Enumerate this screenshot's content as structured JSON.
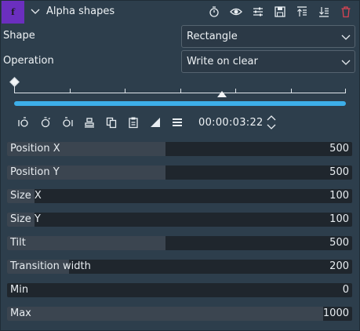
{
  "effect": {
    "badge": "f",
    "title": "Alpha shapes"
  },
  "fields": {
    "shape_label": "Shape",
    "shape_value": "Rectangle",
    "operation_label": "Operation",
    "operation_value": "Write on clear"
  },
  "timeline": {
    "timecode": "00:00:03:22"
  },
  "params": [
    {
      "name": "Position X",
      "value": "500",
      "fraction": 0.46
    },
    {
      "name": "Position Y",
      "value": "500",
      "fraction": 0.46
    },
    {
      "name": "Size X",
      "value": "100",
      "fraction": 0.08
    },
    {
      "name": "Size Y",
      "value": "100",
      "fraction": 0.08
    },
    {
      "name": "Tilt",
      "value": "500",
      "fraction": 0.46
    },
    {
      "name": "Transition width",
      "value": "200",
      "fraction": 0.18
    },
    {
      "name": "Min",
      "value": "0",
      "fraction": 0.0
    },
    {
      "name": "Max",
      "value": "1000",
      "fraction": 0.915
    }
  ],
  "icons": {
    "header": [
      "timer-icon",
      "eye-icon",
      "settings-sliders-icon",
      "save-icon",
      "move-up-icon",
      "move-down-icon",
      "delete-icon"
    ],
    "toolbar": [
      "previous-keyframe-icon",
      "add-keyframe-icon",
      "next-keyframe-icon",
      "align-icon",
      "copy-icon",
      "paste-icon",
      "interpolation-icon",
      "menu-icon"
    ]
  },
  "colors": {
    "accent": "#3daee9",
    "badge": "#6b2fbf",
    "delete": "#da4453",
    "background": "#2d3e4c"
  }
}
